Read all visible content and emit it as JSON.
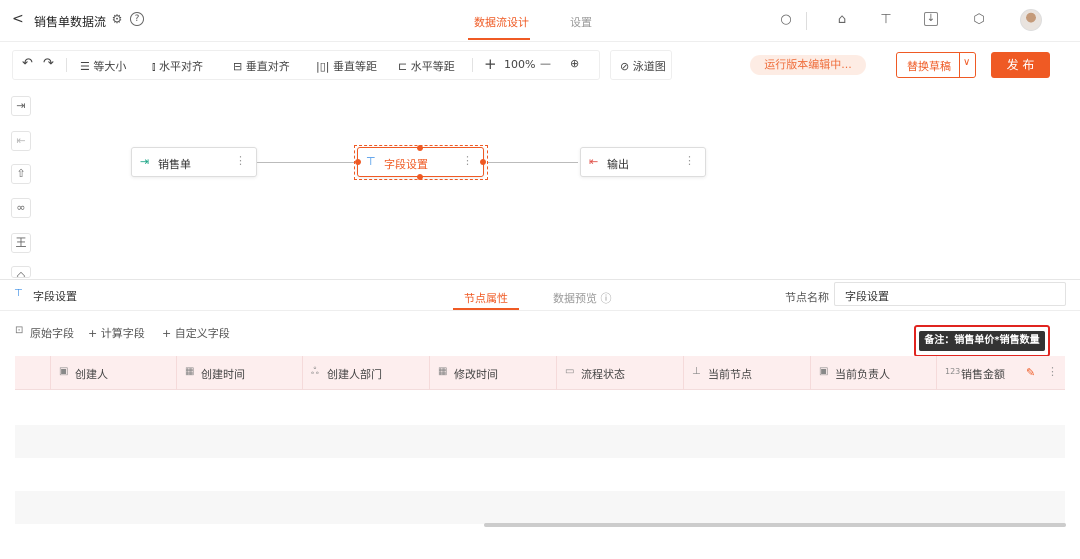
{
  "header": {
    "back": "<",
    "title": "销售单数据流",
    "tabs": [
      {
        "label": "数据流设计",
        "active": true
      },
      {
        "label": "设置",
        "active": false
      }
    ]
  },
  "toolbar": {
    "undo": "↶",
    "redo": "↷",
    "equal_size": "等大小",
    "h_align": "水平对齐",
    "v_align": "垂直对齐",
    "v_spacing": "垂直等距",
    "h_spacing": "水平等距",
    "zoom_in": "+",
    "zoom": "100%",
    "zoom_out": "—",
    "lane": "泳道图",
    "status_pill": "运行版本编辑中...",
    "replace_draft": "替换草稿",
    "publish": "发 布"
  },
  "canvas": {
    "nodes": [
      {
        "label": "销售单"
      },
      {
        "label": "字段设置"
      },
      {
        "label": "输出"
      }
    ]
  },
  "panel": {
    "title": "字段设置",
    "tabs": [
      {
        "label": "节点属性",
        "active": true
      },
      {
        "label": "数据预览 ⓘ",
        "active": false
      }
    ],
    "node_name_label": "节点名称",
    "node_name_value": "字段设置",
    "sub_tabs": [
      "原始字段",
      "+ 计算字段",
      "+ 自定义字段"
    ],
    "callout": "备注：销售单价*销售数量",
    "columns": [
      {
        "icon": "▣",
        "label": "创建人"
      },
      {
        "icon": "▦",
        "label": "创建时间"
      },
      {
        "icon": "ஃ",
        "label": "创建人部门"
      },
      {
        "icon": "▦",
        "label": "修改时间"
      },
      {
        "icon": "▭",
        "label": "流程状态"
      },
      {
        "icon": "⊥",
        "label": "当前节点"
      },
      {
        "icon": "▣",
        "label": "当前负责人"
      },
      {
        "icon": "123",
        "label": "销售金额"
      }
    ]
  },
  "colors": {
    "accent": "#ef5a24",
    "callout_border": "#e0241f"
  }
}
